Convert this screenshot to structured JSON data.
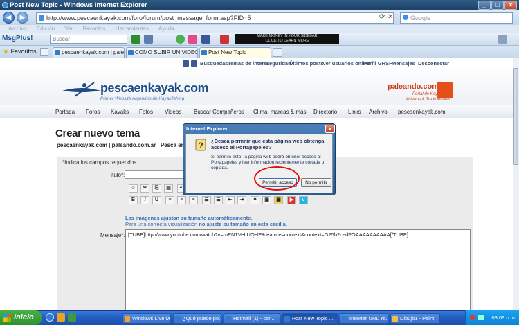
{
  "window": {
    "title": "Post New Topic - Windows Internet Explorer"
  },
  "address": {
    "url": "http://www.pescaenkayak.com/foro/forum/post_message_form.asp?FID=5",
    "search_placeholder": "Google"
  },
  "menu": [
    "Archivo",
    "Edición",
    "Ver",
    "Favoritos",
    "Herramientas",
    "Ayuda"
  ],
  "toolbar": {
    "msgplus": "MsgPlus!",
    "search_placeholder": "Buscar",
    "banner_line1": "MAKE MONEY IN YOUR SIDEBAR",
    "banner_line2": "CLICK TO LEARN MORE"
  },
  "tabs": {
    "favorites": "Favoritos",
    "items": [
      {
        "label": "pescaenkayak.com | paleando...",
        "active": false
      },
      {
        "label": "COMO SUBIR UN VIDEO?",
        "active": false
      },
      {
        "label": "Post New Topic",
        "active": true
      }
    ]
  },
  "site": {
    "toplinks": [
      "Búsquedas",
      "Temas de interés",
      "Seguridad",
      "Últimos posts",
      "Ver usuarios online",
      "Perfil GRSH",
      "Mensajes",
      "Desconectar"
    ],
    "logo": "pescaenkayak.com",
    "logo_sub": "Primer Website Argentino de Kayakfishing",
    "partner": "paleando.com.ar",
    "partner_sub1": "Portal de Kayaks",
    "partner_sub2": "Abiertos & Tradicionales",
    "nav": [
      "Portada",
      "Foros",
      "Kayaks",
      "Fotos",
      "Videos",
      "Buscar Compañeros",
      "Clima, mareas & más",
      "Directorio",
      "Links",
      "Archivo",
      "pescaenkayak.com"
    ]
  },
  "form": {
    "heading": "Crear nuevo tema",
    "breadcrumb": "pescaenkayak.com | paleando.com.ar | Pesca en Kayak",
    "required_note": "*Indica los campos requeridos",
    "title_label": "Título*:",
    "image_note1": "Las imágenes ajustan su tamaño automáticamente.",
    "image_note2a": "Para una correcta visualización ",
    "image_note2b": "no ajuste su tamaño en esta casilla.",
    "message_label": "Mensaje*:",
    "message_value": "[TUBE]http://www.youtube.com/watch?v=mEN1VeLUQHE&feature=context&context=G25b2cedFOAAAAAAAAAA[/TUBE]",
    "editor_buttons": [
      "B",
      "I",
      "U"
    ]
  },
  "dialog": {
    "title": "Internet Explorer",
    "question": "¿Desea permitir que esta página web obtenga acceso al Portapapeles?",
    "info": "Si permite esto, la página web podrá obtener acceso al Portapapeles y leer información recientemente cortada o copiada.",
    "allow": "Permitir acceso",
    "deny": "No permitir"
  },
  "taskbar": {
    "start": "Inicio",
    "items": [
      {
        "label": "Windows Live M...",
        "active": false
      },
      {
        "label": "¿Qué puede po...",
        "active": false
      },
      {
        "label": "Hotmail (1) - car...",
        "active": false
      },
      {
        "label": "Post New Topic ...",
        "active": true
      },
      {
        "label": "Insertar URL Yo...",
        "active": false
      },
      {
        "label": "Dibujo1 - Paint",
        "active": false
      }
    ],
    "clock": "03:09 p.m."
  }
}
